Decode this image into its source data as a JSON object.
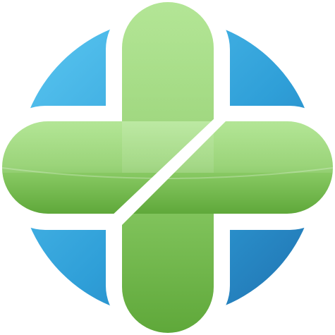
{
  "logo": {
    "icon": "medical-cross-logo",
    "colors": {
      "cross_light": "#a3e07f",
      "cross_mid": "#8fcf6a",
      "cross_dark": "#5fa83a",
      "circle_light": "#5cc8f2",
      "circle_mid": "#2f9fd8",
      "circle_dark": "#1f6fae",
      "gap": "#ffffff",
      "background": "#ffffff"
    }
  }
}
